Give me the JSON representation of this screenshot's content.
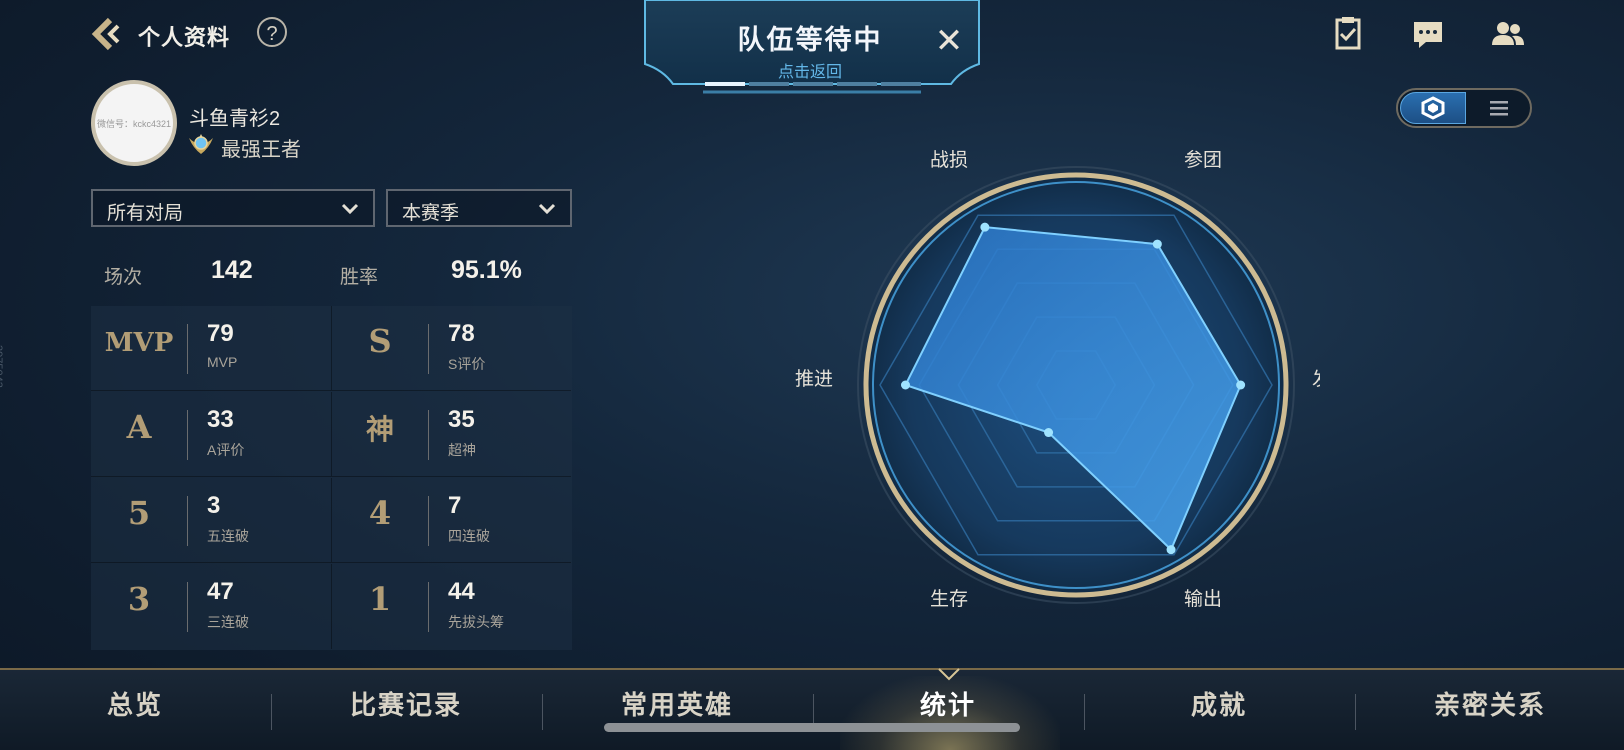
{
  "header": {
    "title": "个人资料",
    "help_label": "?",
    "queue": {
      "title": "队伍等待中",
      "subtitle": "点击返回",
      "close": "✕"
    },
    "icons": [
      "checklist-icon",
      "chat-icon",
      "friends-icon"
    ],
    "view_toggle": {
      "options": [
        "hexagon-view-icon",
        "list-view-icon"
      ],
      "selected": "hexagon-view-icon"
    }
  },
  "profile": {
    "avatar_text": "微信号：kckc4321",
    "name": "斗鱼青衫2",
    "rank": "最强王者"
  },
  "filters": {
    "mode": "所有对局",
    "season": "本赛季"
  },
  "summary": {
    "matches_label": "场次",
    "matches_value": "142",
    "winrate_label": "胜率",
    "winrate_value": "95.1%"
  },
  "stats": [
    {
      "glyph": "MVP",
      "value": "79",
      "label": "MVP"
    },
    {
      "glyph": "S",
      "value": "78",
      "label": "S评价"
    },
    {
      "glyph": "A",
      "value": "33",
      "label": "A评价"
    },
    {
      "glyph": "神",
      "value": "35",
      "label": "超神"
    },
    {
      "glyph": "5",
      "value": "3",
      "label": "五连破"
    },
    {
      "glyph": "4",
      "value": "7",
      "label": "四连破"
    },
    {
      "glyph": "3",
      "value": "47",
      "label": "三连破"
    },
    {
      "glyph": "1",
      "value": "44",
      "label": "先拔头筹"
    }
  ],
  "side_text": "3975043",
  "radar": {
    "labels": [
      "战损",
      "参团",
      "发育",
      "输出",
      "生存",
      "推进"
    ],
    "values": [
      0.93,
      0.83,
      0.84,
      0.97,
      0.28,
      0.87
    ]
  },
  "nav": {
    "tabs": [
      "总览",
      "比赛记录",
      "常用英雄",
      "统计",
      "成就",
      "亲密关系"
    ],
    "active": "统计"
  },
  "colors": {
    "accent": "#63b7e8",
    "gold": "#b29d76",
    "radar_fill": "#3f8fe0"
  }
}
